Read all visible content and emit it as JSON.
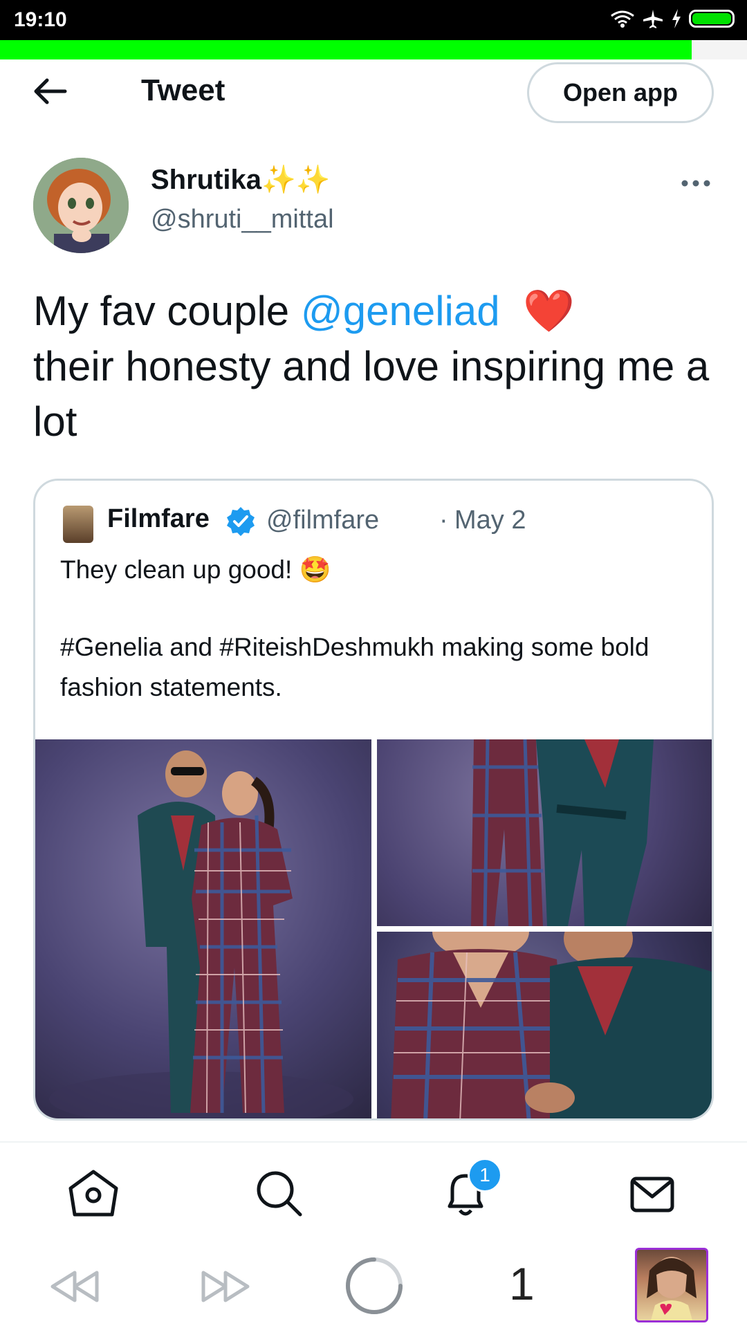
{
  "status_bar": {
    "time": "19:10"
  },
  "page_progress": 0.926,
  "header": {
    "title": "Tweet",
    "open_app": "Open app"
  },
  "tweet": {
    "author_name": "Shrutika",
    "author_emoji": "✨✨",
    "author_handle": "@shruti__mittal",
    "text_before": "My fav couple ",
    "mention": "@geneliad",
    "text_emoji": "❤️",
    "text_after": "their honesty and love inspiring me a lot"
  },
  "quote": {
    "name": "Filmfare",
    "handle": "@filmfare",
    "separator": "·",
    "date": "May 2",
    "line1": "They clean up good! 🤩",
    "line2": "#Genelia and #RiteishDeshmukh making some bold fashion statements."
  },
  "nav": {
    "notification_count": "1"
  },
  "browser": {
    "tab_count": "1"
  },
  "colors": {
    "accent": "#1d9bf0",
    "progress": "#00ff00",
    "text": "#0f1419",
    "muted": "#536471"
  }
}
